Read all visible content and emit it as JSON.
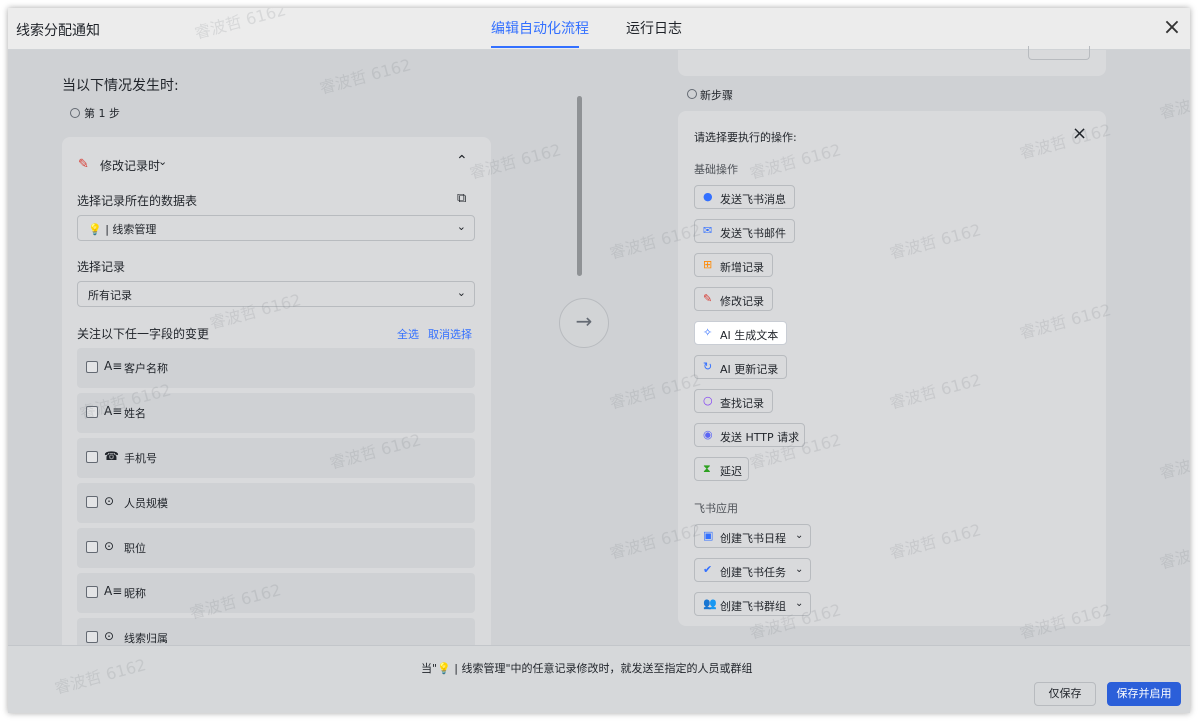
{
  "header": {
    "title": "线索分配通知",
    "tabs": [
      {
        "label": "编辑自动化流程",
        "active": true
      },
      {
        "label": "运行日志",
        "active": false
      }
    ],
    "close_icon": "close-icon"
  },
  "left": {
    "when_title": "当以下情况发生时:",
    "step_label": "第 1 步",
    "trigger": {
      "label": "修改记录时",
      "icon": "edit-icon"
    },
    "table_label": "选择记录所在的数据表",
    "table_value": "💡 | 线索管理",
    "record_label": "选择记录",
    "record_value": "所有记录",
    "fields_label": "关注以下任一字段的变更",
    "select_all": "全选",
    "deselect": "取消选择",
    "fields": [
      {
        "label": "客户名称",
        "icon": "text-field-icon",
        "glyph": "A≡"
      },
      {
        "label": "姓名",
        "icon": "text-field-icon",
        "glyph": "A≡"
      },
      {
        "label": "手机号",
        "icon": "phone-icon",
        "glyph": "☎"
      },
      {
        "label": "人员规模",
        "icon": "single-select-icon",
        "glyph": "⊙"
      },
      {
        "label": "职位",
        "icon": "single-select-icon",
        "glyph": "⊙"
      },
      {
        "label": "昵称",
        "icon": "text-field-icon",
        "glyph": "A≡"
      },
      {
        "label": "线索归属",
        "icon": "single-select-icon",
        "glyph": "⊙"
      }
    ]
  },
  "right": {
    "new_step_label": "新步骤",
    "panel_title": "请选择要执行的操作:",
    "basic_section": "基础操作",
    "basic_ops": [
      {
        "label": "发送飞书消息",
        "icon": "message-icon",
        "glyph": "●",
        "color": "#3370ff"
      },
      {
        "label": "发送飞书邮件",
        "icon": "mail-icon",
        "glyph": "✉",
        "color": "#3370ff"
      },
      {
        "label": "新增记录",
        "icon": "add-record-icon",
        "glyph": "⊞",
        "color": "#ff8800"
      },
      {
        "label": "修改记录",
        "icon": "edit-icon",
        "glyph": "✎",
        "color": "#d83931"
      },
      {
        "label": "AI 生成文本",
        "icon": "ai-sparkle-icon",
        "glyph": "✧",
        "color": "#3370ff"
      },
      {
        "label": "AI 更新记录",
        "icon": "refresh-icon",
        "glyph": "↻",
        "color": "#3370ff"
      },
      {
        "label": "查找记录",
        "icon": "search-icon",
        "glyph": "○",
        "color": "#7f3bf5"
      },
      {
        "label": "发送 HTTP 请求",
        "icon": "globe-icon",
        "glyph": "◉",
        "color": "#5b65f5"
      },
      {
        "label": "延迟",
        "icon": "hourglass-icon",
        "glyph": "⧗",
        "color": "#2ea121"
      }
    ],
    "feishu_section": "飞书应用",
    "feishu_ops": [
      {
        "label": "创建飞书日程",
        "icon": "calendar-icon",
        "glyph": "▣",
        "color": "#3370ff"
      },
      {
        "label": "创建飞书任务",
        "icon": "check-icon",
        "glyph": "✔",
        "color": "#3370ff"
      },
      {
        "label": "创建飞书群组",
        "icon": "group-icon",
        "glyph": "👥",
        "color": "#3370ff"
      }
    ]
  },
  "footer": {
    "description": "当\"💡 | 线索管理\"中的任意记录修改时，就发送至指定的人员或群组",
    "save_only": "仅保存",
    "save_enable": "保存并启用"
  },
  "watermark": "睿波哲 6162",
  "colors": {
    "accent": "#3370ff",
    "primary_button": "#2b5fd9"
  }
}
